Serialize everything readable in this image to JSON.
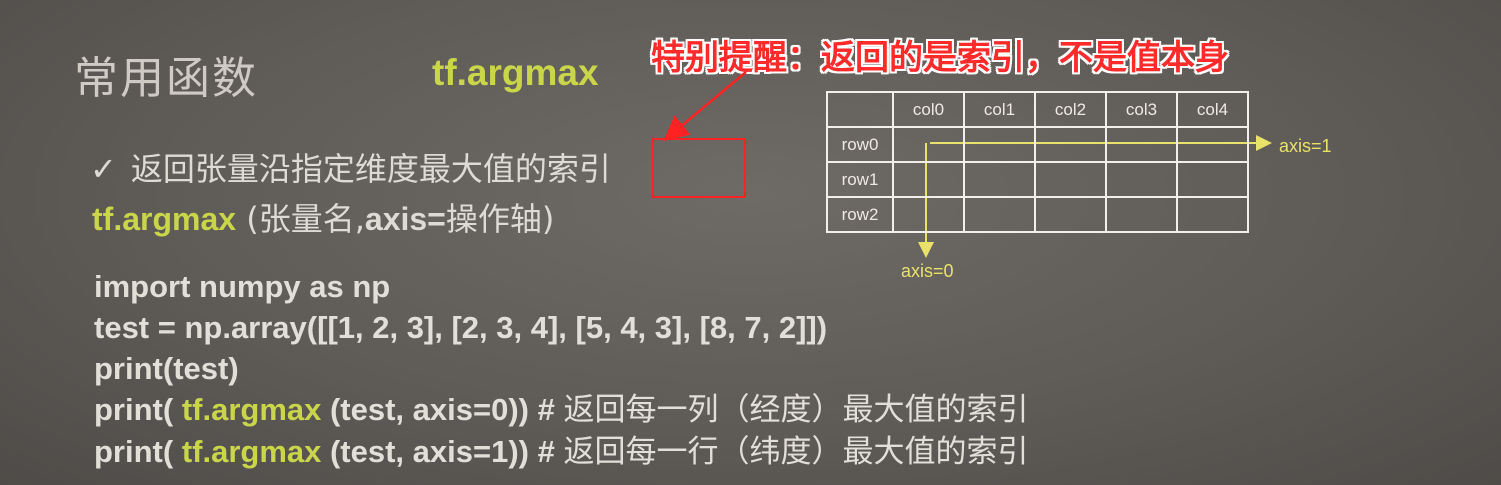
{
  "slide": {
    "title": "常用函数",
    "function_name": "tf.argmax",
    "annotation": "特别提醒：返回的是索引，不是值本身",
    "bullet": {
      "check": "✓",
      "text_before": "返回张量沿指定维度最大值的",
      "text_highlight": "索引"
    },
    "syntax": {
      "fn": "tf.argmax",
      "args_open": " (张量名,",
      "axis_kw": "axis=",
      "axis_cn": "操作轴",
      "close": ")"
    },
    "code": {
      "line1": "import numpy as np",
      "line2": "test = np.array([[1, 2, 3], [2, 3, 4], [5, 4, 3], [8, 7, 2]])",
      "line3": "print(test)",
      "line4_pre": "print( ",
      "line4_fn": "tf.argmax",
      "line4_args": " (test, axis=0))  # ",
      "line4_comment": "返回每一列（经度）最大值的索引",
      "line5_pre": "print( ",
      "line5_fn": "tf.argmax",
      "line5_args": " (test, axis=1))  # ",
      "line5_comment": "返回每一行（纬度）最大值的索引"
    },
    "table": {
      "columns": [
        "col0",
        "col1",
        "col2",
        "col3",
        "col4"
      ],
      "rows": [
        "row0",
        "row1",
        "row2"
      ],
      "axis1_label": "axis=1",
      "axis0_label": "axis=0"
    }
  },
  "colors": {
    "background": "#5f5b57",
    "accent_yellow": "#c9d64a",
    "annotation_red": "#ff2a2a",
    "text": "#dedad4"
  }
}
